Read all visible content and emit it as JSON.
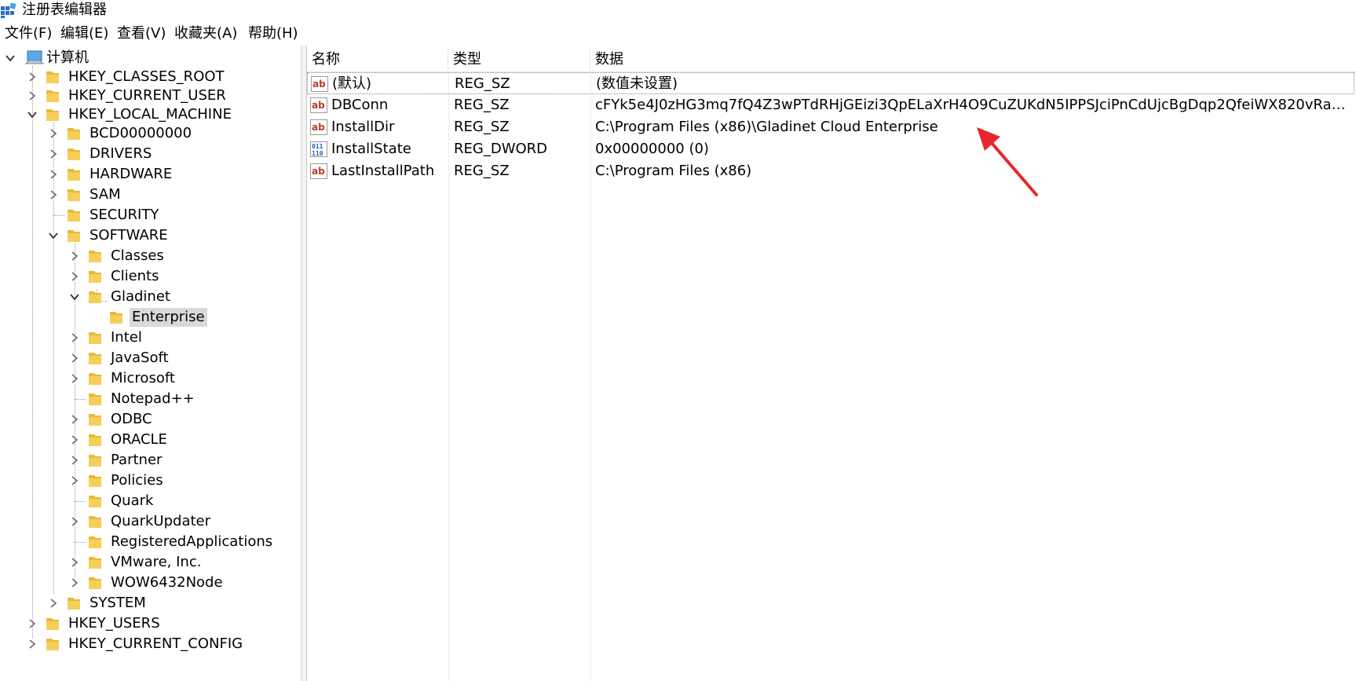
{
  "window": {
    "title": "注册表编辑器",
    "icon": "registry-editor-icon"
  },
  "menu": [
    "文件(F)",
    "编辑(E)",
    "查看(V)",
    "收藏夹(A)",
    "帮助(H)"
  ],
  "tree": {
    "root": "计算机",
    "hives": {
      "classes_root": "HKEY_CLASSES_ROOT",
      "current_user": "HKEY_CURRENT_USER",
      "local_machine": "HKEY_LOCAL_MACHINE",
      "users": "HKEY_USERS",
      "current_config": "HKEY_CURRENT_CONFIG"
    },
    "hklm_children": [
      "BCD00000000",
      "DRIVERS",
      "HARDWARE",
      "SAM",
      "SECURITY",
      "SOFTWARE",
      "SYSTEM"
    ],
    "software_children": [
      "Classes",
      "Clients",
      "Gladinet",
      "Intel",
      "JavaSoft",
      "Microsoft",
      "Notepad++",
      "ODBC",
      "ORACLE",
      "Partner",
      "Policies",
      "Quark",
      "QuarkUpdater",
      "RegisteredApplications",
      "VMware, Inc.",
      "WOW6432Node"
    ],
    "gladinet_child": "Enterprise",
    "selected": "Enterprise"
  },
  "columns": {
    "name": "名称",
    "type": "类型",
    "data": "数据"
  },
  "values": [
    {
      "name": "(默认)",
      "type": "REG_SZ",
      "data": "(数值未设置)",
      "icon": "string-value-icon"
    },
    {
      "name": "DBConn",
      "type": "REG_SZ",
      "data": "cFYk5e4J0zHG3mq7fQ4Z3wPTdRHjGEizi3QpELaXrH4O9CuZUKdN5IPPSJciPnCdUjcBgDqp2QfeiWX820vRaNR...",
      "icon": "string-value-icon"
    },
    {
      "name": "InstallDir",
      "type": "REG_SZ",
      "data": "C:\\Program Files (x86)\\Gladinet Cloud Enterprise",
      "icon": "string-value-icon"
    },
    {
      "name": "InstallState",
      "type": "REG_DWORD",
      "data": "0x00000000 (0)",
      "icon": "binary-value-icon"
    },
    {
      "name": "LastInstallPath",
      "type": "REG_SZ",
      "data": "C:\\Program Files (x86)",
      "icon": "string-value-icon"
    }
  ],
  "colors": {
    "selection": "#d9d9d9",
    "annotation_arrow": "#e8262b",
    "folder": "#f2c84b"
  }
}
